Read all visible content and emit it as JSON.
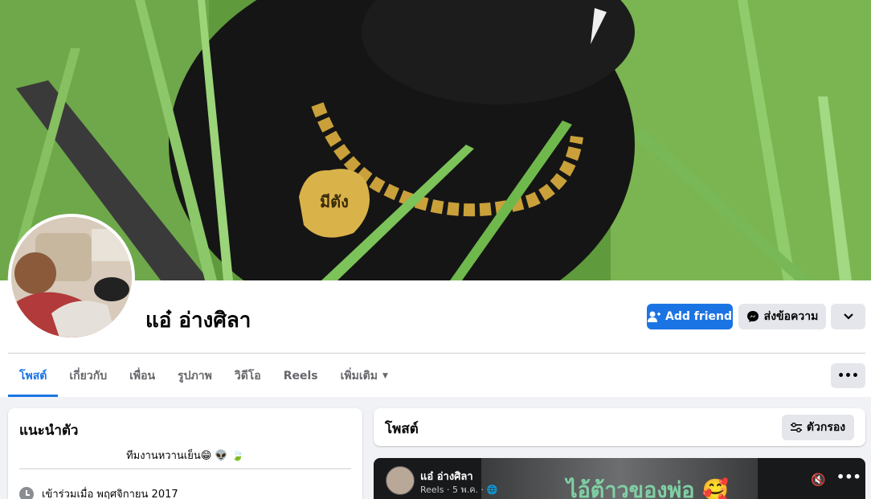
{
  "profile": {
    "name": "แอ๋ อ่างศิลา"
  },
  "actions": {
    "add_friend": "Add friend",
    "message": "ส่งข้อความ"
  },
  "tabs": [
    {
      "label": "โพสต์"
    },
    {
      "label": "เกี่ยวกับ"
    },
    {
      "label": "เพื่อน"
    },
    {
      "label": "รูปภาพ"
    },
    {
      "label": "วิดีโอ"
    },
    {
      "label": "Reels"
    },
    {
      "label": "เพิ่มเติม"
    }
  ],
  "tabs_more": "•••",
  "intro": {
    "title": "แนะนำตัว",
    "bio": "ทีมงานหวานเย็น😁 👽 🍃",
    "joined": "เข้าร่วมเมื่อ พฤศจิกายน 2017"
  },
  "posts": {
    "title": "โพสต์",
    "filter_label": "ตัวกรอง"
  },
  "reel_post": {
    "author": "แอ๋ อ่างศิลา",
    "meta": "Reels · 5 พ.ค. ·",
    "caption": "ไอ้ต้าวของพ่อ 🥰",
    "more": "•••"
  },
  "cover_tag_text": "มีตัง",
  "colors": {
    "accent": "#1b74e4",
    "background": "#f0f2f5",
    "button_gray": "#e4e6eb"
  }
}
